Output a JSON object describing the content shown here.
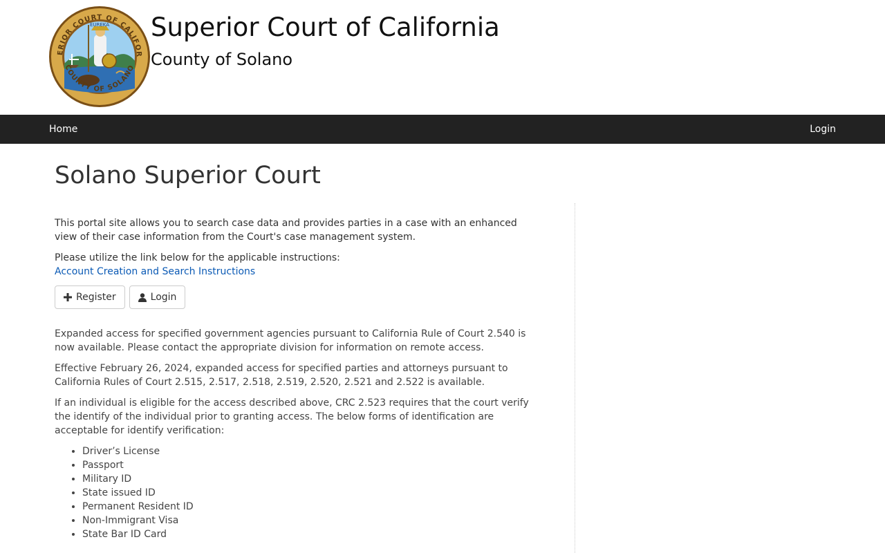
{
  "header": {
    "title": "Superior Court of California",
    "subtitle": "County of Solano",
    "seal": {
      "top_text": "SUPERIOR COURT OF CALIFORNIA",
      "motto": "EUREKA",
      "bottom_text": "COUNTY OF SOLANO"
    }
  },
  "nav": {
    "home_label": "Home",
    "login_label": "Login"
  },
  "main": {
    "title": "Solano Superior Court",
    "intro": "This portal site allows you to search case data and provides parties in a case with an enhanced view of their case information from the Court's case management system.",
    "instructions_label": "Please utilize the link below for the applicable instructions:",
    "instructions_link": "Account Creation and Search Instructions",
    "register_label": "Register",
    "login_label": "Login",
    "paragraph_gov": "Expanded access for specified government agencies pursuant to California Rule of Court 2.540 is now available. Please contact the appropriate division for information on remote access.",
    "paragraph_effective": "Effective February 26, 2024, expanded access for specified parties and attorneys pursuant to California Rules of Court 2.515, 2.517, 2.518, 2.519, 2.520, 2.521 and 2.522 is available.",
    "paragraph_eligible": "If an individual is eligible for the access described above, CRC 2.523 requires that the court verify the identify of the individual prior to granting access. The below forms of identification are acceptable for identify verification:",
    "id_forms": [
      "Driver’s License",
      "Passport",
      "Military ID",
      "State issued ID",
      "Permanent Resident ID",
      "Non-Immigrant Visa",
      "State Bar ID Card"
    ]
  },
  "colors": {
    "navbar": "#222222",
    "link": "#0b5ab5",
    "seal_gold": "#c9a227",
    "seal_ring": "#9a6a1e"
  }
}
